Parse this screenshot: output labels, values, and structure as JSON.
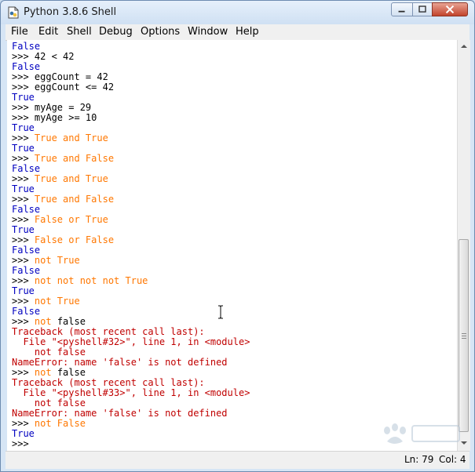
{
  "window": {
    "title": "Python 3.8.6 Shell"
  },
  "menu": [
    "File",
    "Edit",
    "Shell",
    "Debug",
    "Options",
    "Window",
    "Help"
  ],
  "shell_lines": [
    [
      {
        "t": "False",
        "c": "out"
      }
    ],
    [
      {
        "t": ">>> ",
        "c": "prompt"
      },
      {
        "t": "42 < 42",
        "c": "code"
      }
    ],
    [
      {
        "t": "False",
        "c": "out"
      }
    ],
    [
      {
        "t": ">>> ",
        "c": "prompt"
      },
      {
        "t": "eggCount = 42",
        "c": "code"
      }
    ],
    [
      {
        "t": ">>> ",
        "c": "prompt"
      },
      {
        "t": "eggCount <= 42",
        "c": "code"
      }
    ],
    [
      {
        "t": "True",
        "c": "out"
      }
    ],
    [
      {
        "t": ">>> ",
        "c": "prompt"
      },
      {
        "t": "myAge = 29",
        "c": "code"
      }
    ],
    [
      {
        "t": ">>> ",
        "c": "prompt"
      },
      {
        "t": "myAge >= 10",
        "c": "code"
      }
    ],
    [
      {
        "t": "True",
        "c": "out"
      }
    ],
    [
      {
        "t": ">>> ",
        "c": "prompt"
      },
      {
        "t": "True and True",
        "c": "kw"
      }
    ],
    [
      {
        "t": "True",
        "c": "out"
      }
    ],
    [
      {
        "t": ">>> ",
        "c": "prompt"
      },
      {
        "t": "True and False",
        "c": "kw"
      }
    ],
    [
      {
        "t": "False",
        "c": "out"
      }
    ],
    [
      {
        "t": ">>> ",
        "c": "prompt"
      },
      {
        "t": "True and True",
        "c": "kw"
      }
    ],
    [
      {
        "t": "True",
        "c": "out"
      }
    ],
    [
      {
        "t": ">>> ",
        "c": "prompt"
      },
      {
        "t": "True and False",
        "c": "kw"
      }
    ],
    [
      {
        "t": "False",
        "c": "out"
      }
    ],
    [
      {
        "t": ">>> ",
        "c": "prompt"
      },
      {
        "t": "False or True",
        "c": "kw"
      }
    ],
    [
      {
        "t": "True",
        "c": "out"
      }
    ],
    [
      {
        "t": ">>> ",
        "c": "prompt"
      },
      {
        "t": "False or False",
        "c": "kw"
      }
    ],
    [
      {
        "t": "False",
        "c": "out"
      }
    ],
    [
      {
        "t": ">>> ",
        "c": "prompt"
      },
      {
        "t": "not True",
        "c": "kw"
      }
    ],
    [
      {
        "t": "False",
        "c": "out"
      }
    ],
    [
      {
        "t": ">>> ",
        "c": "prompt"
      },
      {
        "t": "not not not not True",
        "c": "kw"
      }
    ],
    [
      {
        "t": "True",
        "c": "out"
      }
    ],
    [
      {
        "t": ">>> ",
        "c": "prompt"
      },
      {
        "t": "not True",
        "c": "kw"
      }
    ],
    [
      {
        "t": "False",
        "c": "out"
      }
    ],
    [
      {
        "t": ">>> ",
        "c": "prompt"
      },
      {
        "t": "not ",
        "c": "kw"
      },
      {
        "t": "false",
        "c": "code"
      }
    ],
    [
      {
        "t": "Traceback (most recent call last):",
        "c": "err"
      }
    ],
    [
      {
        "t": "  File \"<pyshell#32>\", line 1, in <module>",
        "c": "err"
      }
    ],
    [
      {
        "t": "    not false",
        "c": "err"
      }
    ],
    [
      {
        "t": "NameError: name 'false' is not defined",
        "c": "err"
      }
    ],
    [
      {
        "t": ">>> ",
        "c": "prompt"
      },
      {
        "t": "not ",
        "c": "kw"
      },
      {
        "t": "false",
        "c": "code"
      }
    ],
    [
      {
        "t": "Traceback (most recent call last):",
        "c": "err"
      }
    ],
    [
      {
        "t": "  File \"<pyshell#33>\", line 1, in <module>",
        "c": "err"
      }
    ],
    [
      {
        "t": "    not false",
        "c": "err"
      }
    ],
    [
      {
        "t": "NameError: name 'false' is not defined",
        "c": "err"
      }
    ],
    [
      {
        "t": ">>> ",
        "c": "prompt"
      },
      {
        "t": "not False",
        "c": "kw"
      }
    ],
    [
      {
        "t": "True",
        "c": "out"
      }
    ],
    [
      {
        "t": ">>> ",
        "c": "prompt"
      }
    ]
  ],
  "status": {
    "line": "Ln: 79",
    "col": "Col: 4"
  }
}
